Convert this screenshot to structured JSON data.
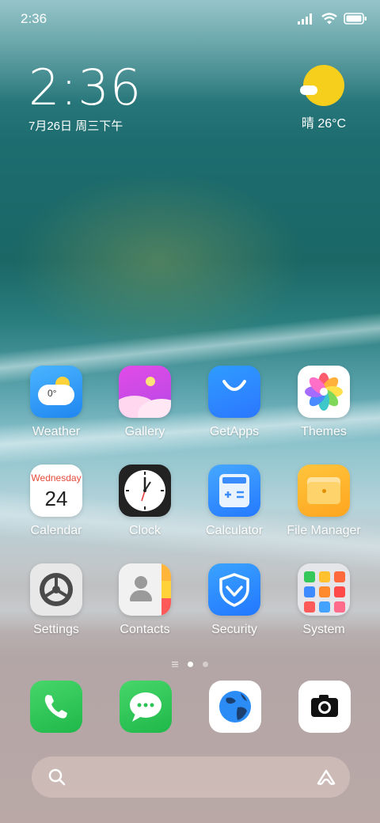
{
  "status_bar": {
    "time": "2:36"
  },
  "clock_widget": {
    "time": "2:36",
    "date": "7月26日 周三下午"
  },
  "weather_widget": {
    "temp": "晴 26°C"
  },
  "apps": [
    {
      "label": "Weather",
      "icon": "weather-icon",
      "badge": "0°"
    },
    {
      "label": "Gallery",
      "icon": "gallery-icon"
    },
    {
      "label": "GetApps",
      "icon": "getapps-icon"
    },
    {
      "label": "Themes",
      "icon": "themes-icon"
    },
    {
      "label": "Calendar",
      "icon": "calendar-icon",
      "weekday": "Wednesday",
      "day": "24"
    },
    {
      "label": "Clock",
      "icon": "clock-icon"
    },
    {
      "label": "Calculator",
      "icon": "calculator-icon"
    },
    {
      "label": "File Manager",
      "icon": "file-manager-icon"
    },
    {
      "label": "Settings",
      "icon": "settings-icon"
    },
    {
      "label": "Contacts",
      "icon": "contacts-icon"
    },
    {
      "label": "Security",
      "icon": "security-icon"
    },
    {
      "label": "System",
      "icon": "system-folder-icon"
    }
  ],
  "dock": [
    {
      "icon": "phone-icon"
    },
    {
      "icon": "messages-icon"
    },
    {
      "icon": "browser-icon"
    },
    {
      "icon": "camera-icon"
    }
  ],
  "search_bar": {
    "icon": "search-icon",
    "assistant_icon": "assistant-icon"
  }
}
